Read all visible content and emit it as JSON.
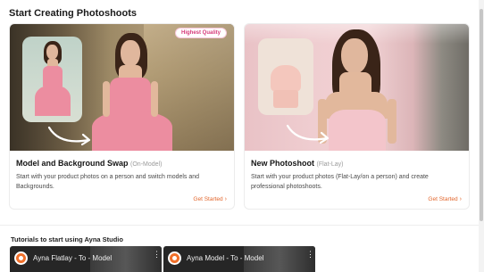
{
  "page": {
    "title": "Start Creating Photoshoots"
  },
  "cards": [
    {
      "title": "Model and Background Swap",
      "tag": "(On-Model)",
      "badge": "Highest Quality",
      "description": "Start with your product photos on a person and switch models and Backgrounds.",
      "cta": "Get Started",
      "cta_icon": "chevron-right-icon"
    },
    {
      "title": "New Photoshoot",
      "tag": "(Flat-Lay)",
      "description": "Start with your product photos (Flat-Lay/on a person) and create professional photoshoots.",
      "cta": "Get Started",
      "cta_icon": "chevron-right-icon"
    }
  ],
  "tutorials": {
    "label": "Tutorials to start using Ayna Studio",
    "videos": [
      {
        "title": "Ayna Flatlay - To - Model"
      },
      {
        "title": "Ayna Model - To - Model"
      }
    ]
  },
  "colors": {
    "accent": "#e2662c",
    "badge_text": "#d63a7a"
  }
}
